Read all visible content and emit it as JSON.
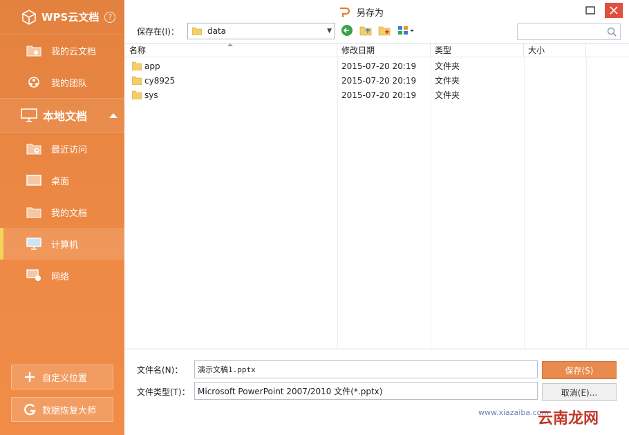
{
  "sidebar": {
    "app_title": "WPS云文档",
    "help_glyph": "?",
    "cloud_items": [
      {
        "label": "我的云文档",
        "icon": "cloud-folder-icon"
      },
      {
        "label": "我的团队",
        "icon": "team-icon"
      }
    ],
    "local_section": {
      "label": "本地文档",
      "icon": "monitor-icon"
    },
    "local_items": [
      {
        "label": "最近访问",
        "icon": "recent-folder-icon"
      },
      {
        "label": "桌面",
        "icon": "desktop-icon"
      },
      {
        "label": "我的文档",
        "icon": "documents-folder-icon"
      },
      {
        "label": "计算机",
        "icon": "computer-icon",
        "active": true
      },
      {
        "label": "网络",
        "icon": "network-icon"
      }
    ],
    "custom_location_label": "自定义位置",
    "data_recovery_label": "数据恢复大师"
  },
  "dialog": {
    "title": "另存为",
    "save_in_label": "保存在(I)：",
    "save_in_value": "data",
    "search_placeholder": "",
    "columns": [
      "名称",
      "修改日期",
      "类型",
      "大小"
    ],
    "rows": [
      {
        "name": "app",
        "modified": "2015-07-20 20:19",
        "type": "文件夹",
        "size": ""
      },
      {
        "name": "cy8925",
        "modified": "2015-07-20 20:19",
        "type": "文件夹",
        "size": ""
      },
      {
        "name": "sys",
        "modified": "2015-07-20 20:19",
        "type": "文件夹",
        "size": ""
      }
    ],
    "filename_label": "文件名(N)：",
    "filename_value": "演示文稿1.pptx",
    "filetype_label": "文件类型(T)：",
    "filetype_value": "Microsoft PowerPoint 2007/2010 文件(*.pptx)",
    "save_button": "保存(S)",
    "cancel_button": "取消(E)..."
  },
  "watermark": {
    "brand_cn": "云南龙网",
    "site": "www.xiazaiba.com"
  },
  "colors": {
    "sidebar_orange": "#ee8a45",
    "active_accent": "#f4d35a",
    "save_button": "#e98a4e",
    "close_button": "#e0503c"
  }
}
